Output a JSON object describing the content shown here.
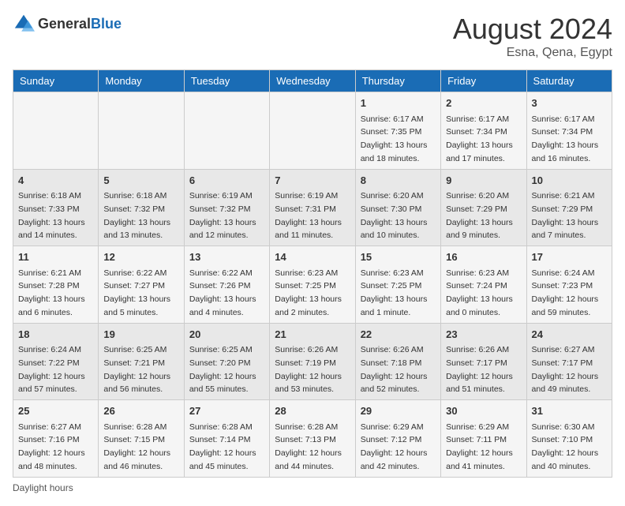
{
  "logo": {
    "text_general": "General",
    "text_blue": "Blue"
  },
  "title": "August 2024",
  "location": "Esna, Qena, Egypt",
  "days_of_week": [
    "Sunday",
    "Monday",
    "Tuesday",
    "Wednesday",
    "Thursday",
    "Friday",
    "Saturday"
  ],
  "footer": "Daylight hours",
  "weeks": [
    [
      {
        "day": "",
        "info": ""
      },
      {
        "day": "",
        "info": ""
      },
      {
        "day": "",
        "info": ""
      },
      {
        "day": "",
        "info": ""
      },
      {
        "day": "1",
        "info": "Sunrise: 6:17 AM\nSunset: 7:35 PM\nDaylight: 13 hours\nand 18 minutes."
      },
      {
        "day": "2",
        "info": "Sunrise: 6:17 AM\nSunset: 7:34 PM\nDaylight: 13 hours\nand 17 minutes."
      },
      {
        "day": "3",
        "info": "Sunrise: 6:17 AM\nSunset: 7:34 PM\nDaylight: 13 hours\nand 16 minutes."
      }
    ],
    [
      {
        "day": "4",
        "info": "Sunrise: 6:18 AM\nSunset: 7:33 PM\nDaylight: 13 hours\nand 14 minutes."
      },
      {
        "day": "5",
        "info": "Sunrise: 6:18 AM\nSunset: 7:32 PM\nDaylight: 13 hours\nand 13 minutes."
      },
      {
        "day": "6",
        "info": "Sunrise: 6:19 AM\nSunset: 7:32 PM\nDaylight: 13 hours\nand 12 minutes."
      },
      {
        "day": "7",
        "info": "Sunrise: 6:19 AM\nSunset: 7:31 PM\nDaylight: 13 hours\nand 11 minutes."
      },
      {
        "day": "8",
        "info": "Sunrise: 6:20 AM\nSunset: 7:30 PM\nDaylight: 13 hours\nand 10 minutes."
      },
      {
        "day": "9",
        "info": "Sunrise: 6:20 AM\nSunset: 7:29 PM\nDaylight: 13 hours\nand 9 minutes."
      },
      {
        "day": "10",
        "info": "Sunrise: 6:21 AM\nSunset: 7:29 PM\nDaylight: 13 hours\nand 7 minutes."
      }
    ],
    [
      {
        "day": "11",
        "info": "Sunrise: 6:21 AM\nSunset: 7:28 PM\nDaylight: 13 hours\nand 6 minutes."
      },
      {
        "day": "12",
        "info": "Sunrise: 6:22 AM\nSunset: 7:27 PM\nDaylight: 13 hours\nand 5 minutes."
      },
      {
        "day": "13",
        "info": "Sunrise: 6:22 AM\nSunset: 7:26 PM\nDaylight: 13 hours\nand 4 minutes."
      },
      {
        "day": "14",
        "info": "Sunrise: 6:23 AM\nSunset: 7:25 PM\nDaylight: 13 hours\nand 2 minutes."
      },
      {
        "day": "15",
        "info": "Sunrise: 6:23 AM\nSunset: 7:25 PM\nDaylight: 13 hours\nand 1 minute."
      },
      {
        "day": "16",
        "info": "Sunrise: 6:23 AM\nSunset: 7:24 PM\nDaylight: 13 hours\nand 0 minutes."
      },
      {
        "day": "17",
        "info": "Sunrise: 6:24 AM\nSunset: 7:23 PM\nDaylight: 12 hours\nand 59 minutes."
      }
    ],
    [
      {
        "day": "18",
        "info": "Sunrise: 6:24 AM\nSunset: 7:22 PM\nDaylight: 12 hours\nand 57 minutes."
      },
      {
        "day": "19",
        "info": "Sunrise: 6:25 AM\nSunset: 7:21 PM\nDaylight: 12 hours\nand 56 minutes."
      },
      {
        "day": "20",
        "info": "Sunrise: 6:25 AM\nSunset: 7:20 PM\nDaylight: 12 hours\nand 55 minutes."
      },
      {
        "day": "21",
        "info": "Sunrise: 6:26 AM\nSunset: 7:19 PM\nDaylight: 12 hours\nand 53 minutes."
      },
      {
        "day": "22",
        "info": "Sunrise: 6:26 AM\nSunset: 7:18 PM\nDaylight: 12 hours\nand 52 minutes."
      },
      {
        "day": "23",
        "info": "Sunrise: 6:26 AM\nSunset: 7:17 PM\nDaylight: 12 hours\nand 51 minutes."
      },
      {
        "day": "24",
        "info": "Sunrise: 6:27 AM\nSunset: 7:17 PM\nDaylight: 12 hours\nand 49 minutes."
      }
    ],
    [
      {
        "day": "25",
        "info": "Sunrise: 6:27 AM\nSunset: 7:16 PM\nDaylight: 12 hours\nand 48 minutes."
      },
      {
        "day": "26",
        "info": "Sunrise: 6:28 AM\nSunset: 7:15 PM\nDaylight: 12 hours\nand 46 minutes."
      },
      {
        "day": "27",
        "info": "Sunrise: 6:28 AM\nSunset: 7:14 PM\nDaylight: 12 hours\nand 45 minutes."
      },
      {
        "day": "28",
        "info": "Sunrise: 6:28 AM\nSunset: 7:13 PM\nDaylight: 12 hours\nand 44 minutes."
      },
      {
        "day": "29",
        "info": "Sunrise: 6:29 AM\nSunset: 7:12 PM\nDaylight: 12 hours\nand 42 minutes."
      },
      {
        "day": "30",
        "info": "Sunrise: 6:29 AM\nSunset: 7:11 PM\nDaylight: 12 hours\nand 41 minutes."
      },
      {
        "day": "31",
        "info": "Sunrise: 6:30 AM\nSunset: 7:10 PM\nDaylight: 12 hours\nand 40 minutes."
      }
    ]
  ]
}
